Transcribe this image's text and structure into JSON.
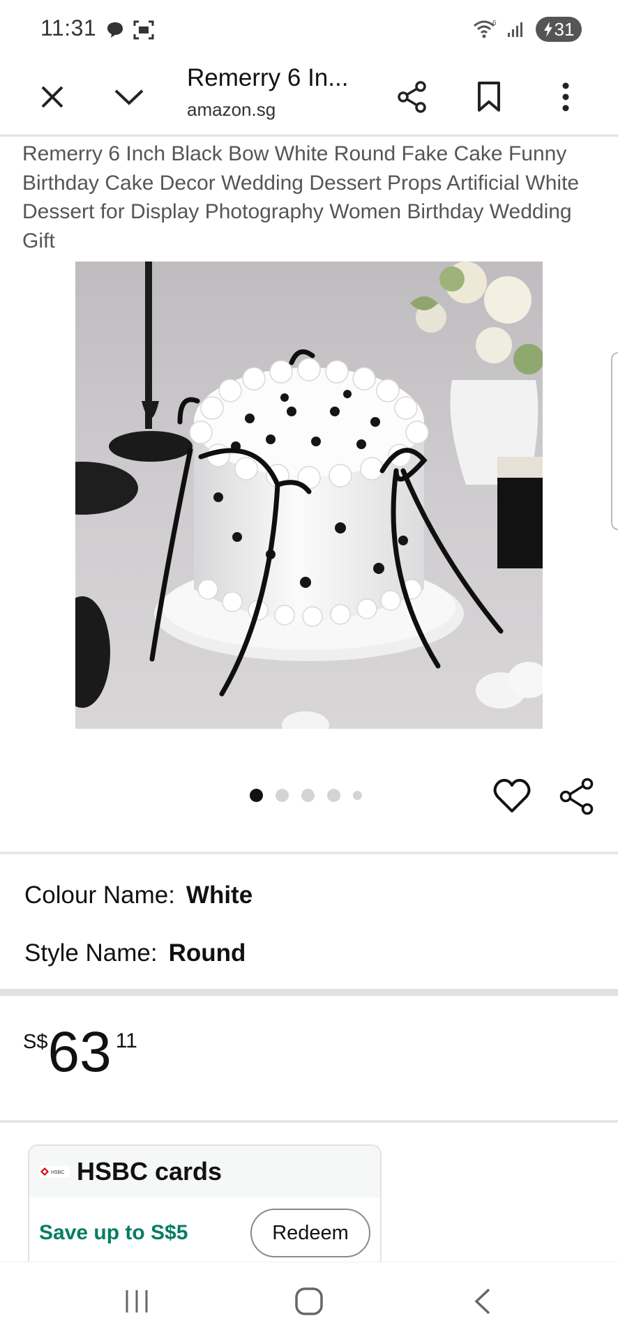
{
  "status_bar": {
    "time": "11:31",
    "battery": "31",
    "icons": [
      "chat-bubble-icon",
      "screenshot-icon",
      "wifi-icon",
      "signal-icon",
      "battery-charging-icon"
    ]
  },
  "browser": {
    "title": "Remerry 6 In...",
    "url": "amazon.sg",
    "icons": [
      "close-icon",
      "chevron-down-icon",
      "share-icon",
      "bookmark-icon",
      "more-vertical-icon"
    ]
  },
  "product": {
    "title": "Remerry 6 Inch Black Bow White Round Fake Cake Funny Birthday Cake Decor Wedding Dessert Props Artificial White Dessert for Display Photography Women Birthday Wedding Gift",
    "image_alt": "White round fake cake with black bows",
    "carousel": {
      "count": 5,
      "active": 0
    }
  },
  "variants": [
    {
      "label": "Colour Name:",
      "value": "White"
    },
    {
      "label": "Style Name:",
      "value": "Round"
    }
  ],
  "price": {
    "currency": "S$",
    "whole": "63",
    "fraction": "11"
  },
  "offer": {
    "title": "HSBC cards",
    "logo_text": "HSBC",
    "save_text": "Save up to S$5",
    "button_label": "Redeem"
  },
  "colors": {
    "save_green": "#067d62",
    "text": "#111111",
    "muted": "#555555"
  }
}
